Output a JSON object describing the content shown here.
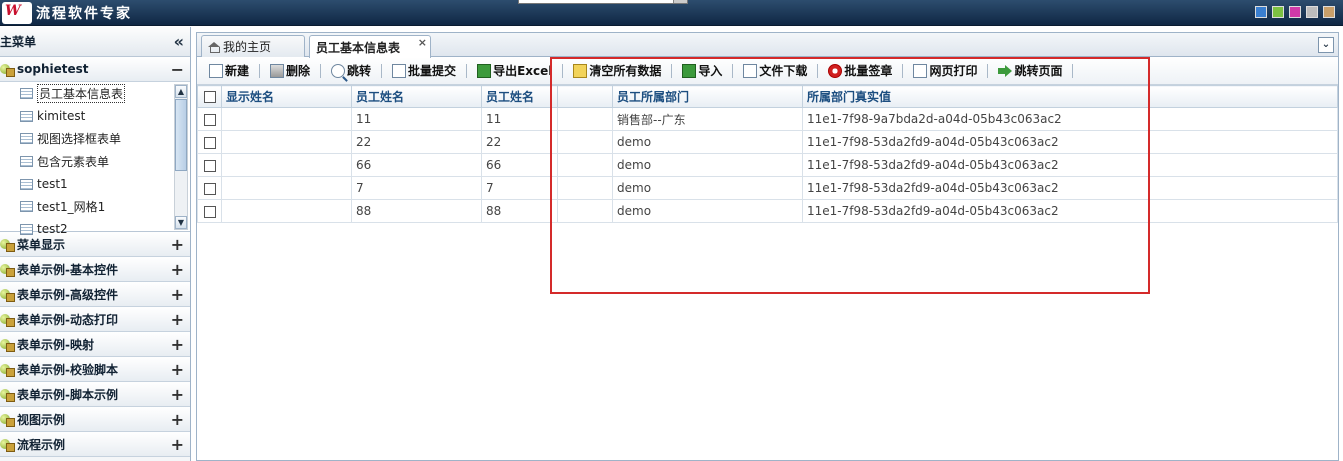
{
  "header": {
    "app_title": "流程软件专家",
    "logo_text": "W",
    "skins": [
      "#3a7fd0",
      "#7dc142",
      "#d03aa8",
      "#bdbdbd",
      "#c9a06a"
    ]
  },
  "sidebar": {
    "title": "主菜单",
    "collapse_glyph": "«",
    "open_group": {
      "label": "sophietest",
      "sign": "−",
      "items": [
        "员工基本信息表",
        "kimitest",
        "视图选择框表单",
        "包含元素表单",
        "test1",
        "test1_网格1",
        "test2"
      ]
    },
    "groups": [
      {
        "label": "菜单显示",
        "sign": "+"
      },
      {
        "label": "表单示例-基本控件",
        "sign": "+"
      },
      {
        "label": "表单示例-高级控件",
        "sign": "+"
      },
      {
        "label": "表单示例-动态打印",
        "sign": "+"
      },
      {
        "label": "表单示例-映射",
        "sign": "+"
      },
      {
        "label": "表单示例-校验脚本",
        "sign": "+"
      },
      {
        "label": "表单示例-脚本示例",
        "sign": "+"
      },
      {
        "label": "视图示例",
        "sign": "+"
      },
      {
        "label": "流程示例",
        "sign": "+"
      }
    ]
  },
  "tabs": {
    "home": "我的主页",
    "active": "员工基本信息表",
    "close": "×",
    "menu_glyph": "⌄"
  },
  "toolbar": {
    "new": "新建",
    "delete": "删除",
    "jump": "跳转",
    "batch_submit": "批量提交",
    "export_excel": "导出Excel",
    "clear_all": "清空所有数据",
    "import": "导入",
    "download": "文件下载",
    "batch_sign": "批量签章",
    "print": "网页打印",
    "goto_page": "跳转页面"
  },
  "grid": {
    "columns": [
      "显示姓名",
      "员工姓名",
      "员工姓名",
      "",
      "员工所属部门",
      "所属部门真实值"
    ],
    "rows": [
      [
        "",
        "11",
        "11",
        "",
        "销售部--广东",
        "11e1-7f98-9a7bda2d-a04d-05b43c063ac2"
      ],
      [
        "",
        "22",
        "22",
        "",
        "demo",
        "11e1-7f98-53da2fd9-a04d-05b43c063ac2"
      ],
      [
        "",
        "66",
        "66",
        "",
        "demo",
        "11e1-7f98-53da2fd9-a04d-05b43c063ac2"
      ],
      [
        "",
        "7",
        "7",
        "",
        "demo",
        "11e1-7f98-53da2fd9-a04d-05b43c063ac2"
      ],
      [
        "",
        "88",
        "88",
        "",
        "demo",
        "11e1-7f98-53da2fd9-a04d-05b43c063ac2"
      ]
    ]
  }
}
